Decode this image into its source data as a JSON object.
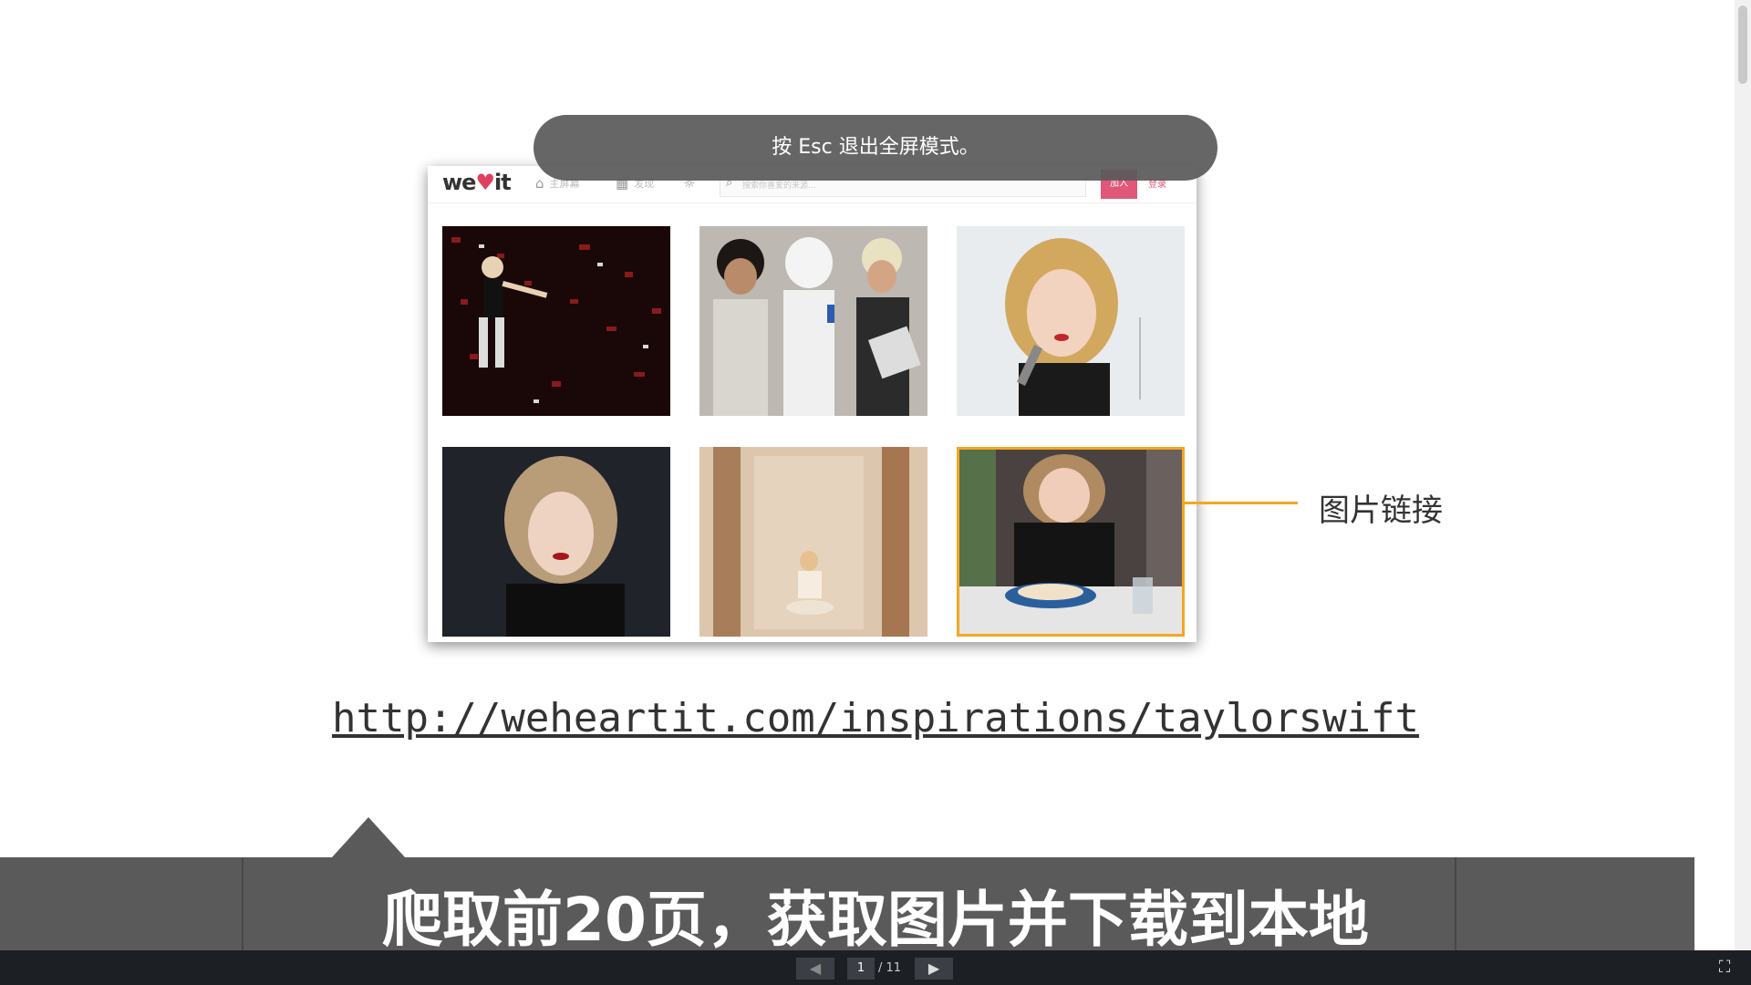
{
  "fullscreen_hint": "按 Esc 退出全屏模式。",
  "embedded_site": {
    "logo": {
      "prefix": "we",
      "heart": "♥",
      "suffix": "it"
    },
    "nav": [
      {
        "label": "主屏幕",
        "icon": "home-icon"
      },
      {
        "label": "发现",
        "icon": "grid-icon"
      },
      {
        "label": "",
        "icon": "lightbulb-icon"
      }
    ],
    "search_placeholder": "搜索你喜爱的来源...",
    "join_button": "加入",
    "login_button": "登录"
  },
  "annotation": "图片链接",
  "url": "http://weheartit.com/inspirations/taylorswift",
  "caption": "爬取前20页，获取图片并下载到本地",
  "controls": {
    "current_page": "1",
    "total": "/ 11"
  },
  "colors": {
    "highlight": "#f5a623",
    "brand": "#e0405e",
    "caption_bg": "#5a5a5a"
  }
}
